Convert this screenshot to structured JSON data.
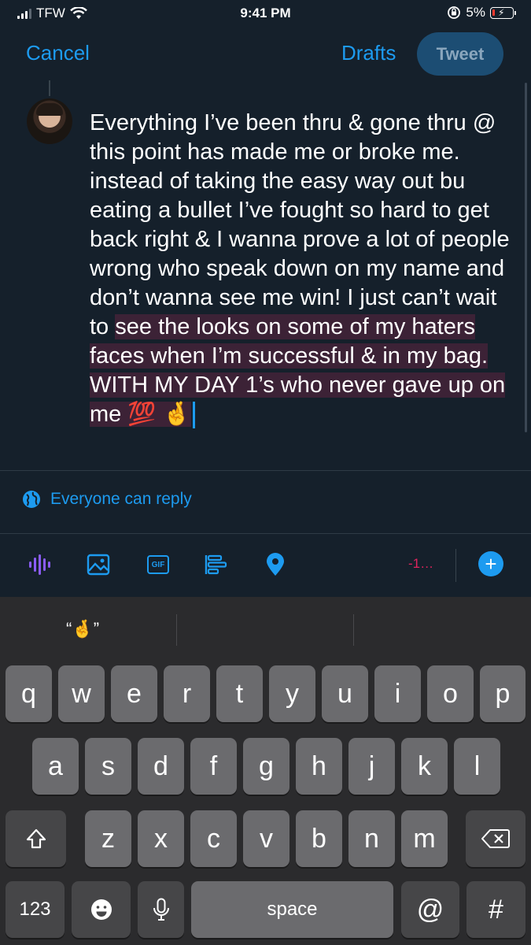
{
  "status_bar": {
    "carrier": "TFW",
    "time": "9:41 PM",
    "battery": "5%"
  },
  "header": {
    "cancel": "Cancel",
    "drafts": "Drafts",
    "tweet": "Tweet"
  },
  "compose": {
    "text_plain": "Everything I’ve been thru & gone thru @ this point has made me or broke me. instead of taking the easy way out bu eating a bullet I’ve fought so hard to get back right & I wanna prove a lot of people wrong who speak down on my name and don’t wanna see me win! I just can’t wait to ",
    "text_highlighted": "see the looks on some of my haters faces when I’m successful & in my bag. WITH MY DAY 1’s who never gave up on me 💯 🤞"
  },
  "reply_setting": "Everyone can reply",
  "toolbar": {
    "char_count": "-1…",
    "gif_label": "GIF",
    "add": "+"
  },
  "colors": {
    "accent": "#1d9bf0",
    "background": "#15202b",
    "over_limit": "#e0245e"
  },
  "keyboard": {
    "suggestion": "“🤞”",
    "row1": [
      "q",
      "w",
      "e",
      "r",
      "t",
      "y",
      "u",
      "i",
      "o",
      "p"
    ],
    "row2": [
      "a",
      "s",
      "d",
      "f",
      "g",
      "h",
      "j",
      "k",
      "l"
    ],
    "row3": [
      "z",
      "x",
      "c",
      "v",
      "b",
      "n",
      "m"
    ],
    "numbers": "123",
    "space": "space",
    "at": "@",
    "hash": "#"
  }
}
